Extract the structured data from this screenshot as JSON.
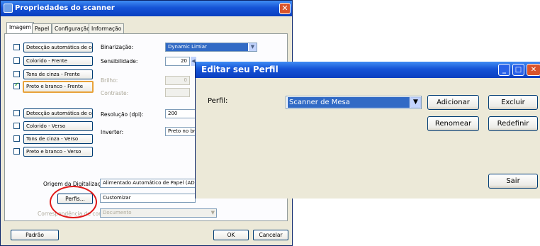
{
  "scanner_window": {
    "title": "Propriedades do scanner",
    "tabs": [
      "Imagem",
      "Papel",
      "Configuração",
      "Informação"
    ],
    "front_images": [
      {
        "label": "Detecção automática de cores",
        "checked": false
      },
      {
        "label": "Colorido - Frente",
        "checked": false
      },
      {
        "label": "Tons de cinza - Frente",
        "checked": false
      },
      {
        "label": "Preto e branco - Frente",
        "checked": true
      }
    ],
    "back_images": [
      {
        "label": "Detecção automática de cores",
        "checked": false
      },
      {
        "label": "Colorido - Verso",
        "checked": false
      },
      {
        "label": "Tons de cinza - Verso",
        "checked": false
      },
      {
        "label": "Preto e branco - Verso",
        "checked": false
      }
    ],
    "binarizacao_label": "Binarização:",
    "binarizacao_value": "Dynamic Limiar",
    "sensibilidade_label": "Sensibilidade:",
    "sensibilidade_value": "20",
    "brilho_label": "Brilho:",
    "brilho_value": "0",
    "contraste_label": "Contraste:",
    "resolucao_label": "Resolução (dpi):",
    "resolucao_value": "200",
    "inverter_label": "Inverter:",
    "inverter_value": "Preto no bra",
    "origem_label": "Origem da Digitalização:",
    "origem_value": "Alimentado Automático de Papel (ADF)",
    "perfis_button": "Perfis...",
    "perfis_value": "Customizar",
    "correspondencia_label": "Correspondência de cores:",
    "correspondencia_value": "Documento",
    "padrao_button": "Padrão",
    "ok_button": "OK",
    "cancelar_button": "Cancelar"
  },
  "profile_dialog": {
    "title": "Editar seu Perfil",
    "perfil_label": "Perfil:",
    "perfil_value": "Scanner de Mesa",
    "adicionar_button": "Adicionar",
    "excluir_button": "Excluir",
    "renomear_button": "Renomear",
    "redefinir_button": "Redefinir",
    "sair_button": "Sair"
  },
  "colors": {
    "titlebar": "#1553d6",
    "dialog_bg": "#ece9d8",
    "selection": "#316ac5",
    "highlight_circle": "#e01818"
  }
}
